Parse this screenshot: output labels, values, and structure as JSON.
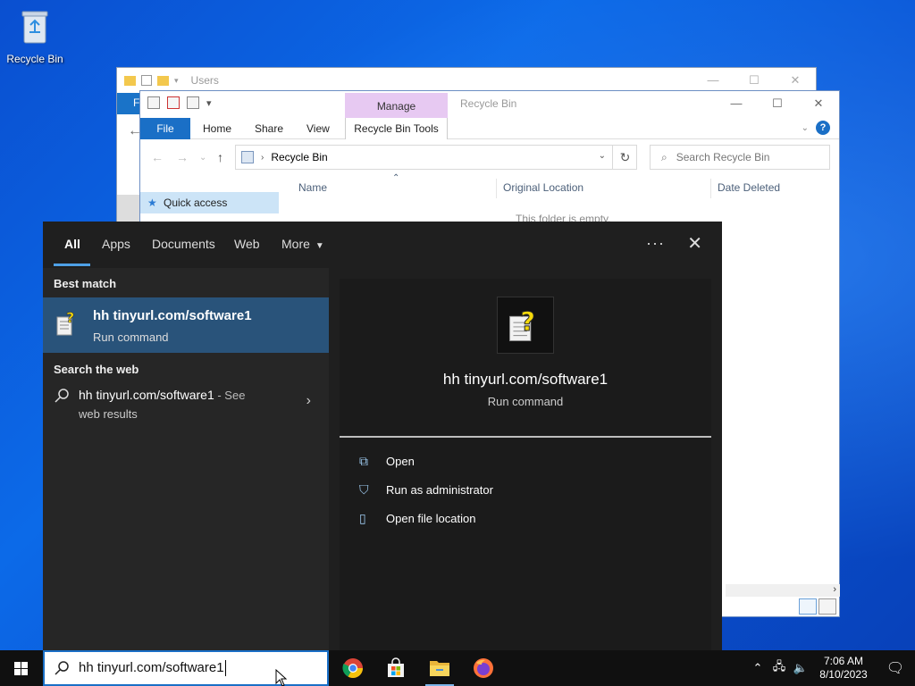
{
  "desktop": {
    "icons": [
      {
        "label": "Recycle Bin",
        "icon": "recycle-bin-icon"
      }
    ]
  },
  "back_window": {
    "title": "Users"
  },
  "explorer": {
    "title": "Recycle Bin",
    "manage_tab": "Manage",
    "tabs": {
      "file": "File",
      "home": "Home",
      "share": "Share",
      "view": "View",
      "recycle_bin_tools": "Recycle Bin Tools"
    },
    "address": "Recycle Bin",
    "search_placeholder": "Search Recycle Bin",
    "columns": [
      "Name",
      "Original Location",
      "Date Deleted"
    ],
    "nav_pane": {
      "quick_access": "Quick access"
    },
    "empty_message": "This folder is empty."
  },
  "search_panel": {
    "tabs": [
      "All",
      "Apps",
      "Documents",
      "Web",
      "More"
    ],
    "active_tab": "All",
    "best_match_heading": "Best match",
    "best_match": {
      "title": "hh tinyurl.com/software1",
      "subtitle": "Run command"
    },
    "web_heading": "Search the web",
    "web_result": {
      "title": "hh tinyurl.com/software1",
      "suffix": " - See",
      "subtitle": "web results"
    },
    "preview": {
      "title": "hh tinyurl.com/software1",
      "subtitle": "Run command"
    },
    "actions": [
      {
        "label": "Open",
        "icon": "open-icon"
      },
      {
        "label": "Run as administrator",
        "icon": "shield-admin-icon"
      },
      {
        "label": "Open file location",
        "icon": "file-location-icon"
      }
    ]
  },
  "taskbar": {
    "search_value": "hh tinyurl.com/software1",
    "apps": [
      "chrome",
      "microsoft-store",
      "file-explorer",
      "firefox"
    ],
    "active_app": "file-explorer",
    "time": "7:06 AM",
    "date": "8/10/2023"
  },
  "colors": {
    "accent": "#1a6fc6",
    "highlight": "#29537a",
    "manage_tab": "#e7c9f2",
    "panel_bg": "#1f1f1f"
  }
}
